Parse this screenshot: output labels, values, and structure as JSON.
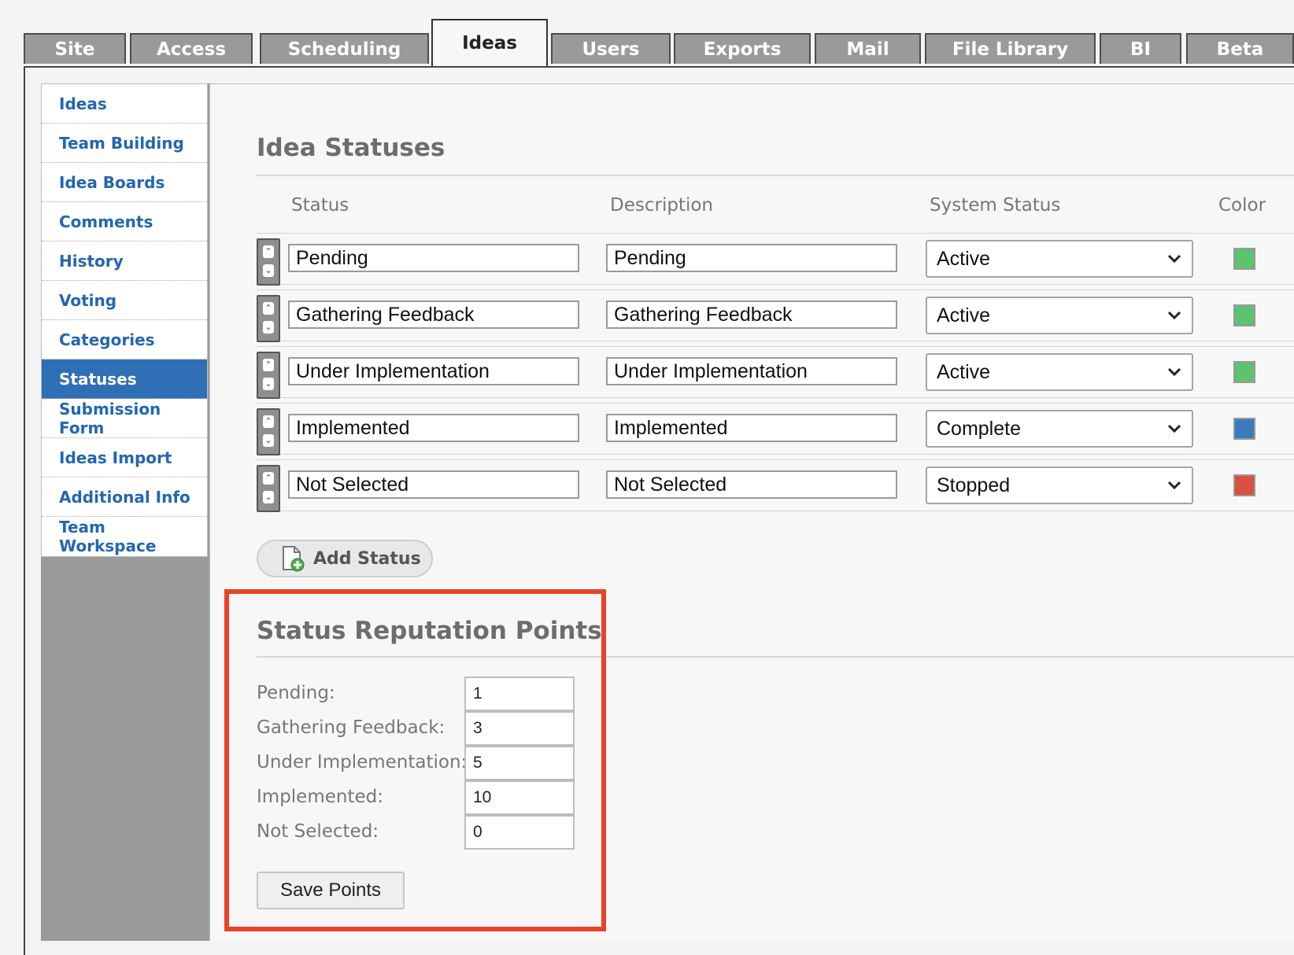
{
  "tabs": [
    {
      "label": "Site"
    },
    {
      "label": "Access"
    },
    {
      "label": "Scheduling"
    },
    {
      "label": "Ideas"
    },
    {
      "label": "Users"
    },
    {
      "label": "Exports"
    },
    {
      "label": "Mail"
    },
    {
      "label": "File Library"
    },
    {
      "label": "BI"
    },
    {
      "label": "Beta"
    }
  ],
  "active_tab": "Ideas",
  "sidebar": {
    "items": [
      {
        "label": "Ideas"
      },
      {
        "label": "Team Building"
      },
      {
        "label": "Idea Boards"
      },
      {
        "label": "Comments"
      },
      {
        "label": "History"
      },
      {
        "label": "Voting"
      },
      {
        "label": "Categories"
      },
      {
        "label": "Statuses"
      },
      {
        "label": "Submission Form"
      },
      {
        "label": "Ideas Import"
      },
      {
        "label": "Additional Info"
      },
      {
        "label": "Team Workspace"
      }
    ],
    "active": "Statuses"
  },
  "statuses_section": {
    "title": "Idea Statuses",
    "columns": {
      "status": "Status",
      "description": "Description",
      "system_status": "System Status",
      "color": "Color"
    },
    "rows": [
      {
        "status": "Pending",
        "description": "Pending",
        "system_status": "Active",
        "color": "#5cc36f"
      },
      {
        "status": "Gathering Feedback",
        "description": "Gathering Feedback",
        "system_status": "Active",
        "color": "#5cc36f"
      },
      {
        "status": "Under Implementation",
        "description": "Under Implementation",
        "system_status": "Active",
        "color": "#5cc36f"
      },
      {
        "status": "Implemented",
        "description": "Implemented",
        "system_status": "Complete",
        "color": "#3a7bc0"
      },
      {
        "status": "Not Selected",
        "description": "Not Selected",
        "system_status": "Stopped",
        "color": "#d9503f"
      }
    ],
    "add_button": "Add Status"
  },
  "reputation": {
    "title": "Status Reputation Points",
    "items": [
      {
        "label": "Pending:",
        "value": "1"
      },
      {
        "label": "Gathering Feedback:",
        "value": "3"
      },
      {
        "label": "Under Implementation:",
        "value": "5"
      },
      {
        "label": "Implemented:",
        "value": "10"
      },
      {
        "label": "Not Selected:",
        "value": "0"
      }
    ],
    "save_button": "Save Points"
  },
  "highlight_color": "#e8422b"
}
